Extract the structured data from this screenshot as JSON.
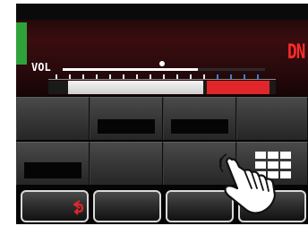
{
  "display": {
    "volume_label": "VOL",
    "mode_indicator": "DN",
    "volume_level": 0.67,
    "gauge": {
      "white_fraction": 0.68,
      "red_start_fraction": 0.68,
      "red_end_fraction": 0.97
    }
  },
  "colors": {
    "level_bar": "#2fa33a",
    "mode_indicator": "#ff2a2a",
    "gauge_red": "#e0262a",
    "scale_ticks_blue": "#3c7fd8",
    "button_face": "#3a3a3a",
    "softkey_border": "#d9d9d9"
  },
  "icons": {
    "back_key": "back-arrow-icon",
    "grid_key": "grid-menu-icon",
    "overlay": "tapping-hand-icon"
  }
}
